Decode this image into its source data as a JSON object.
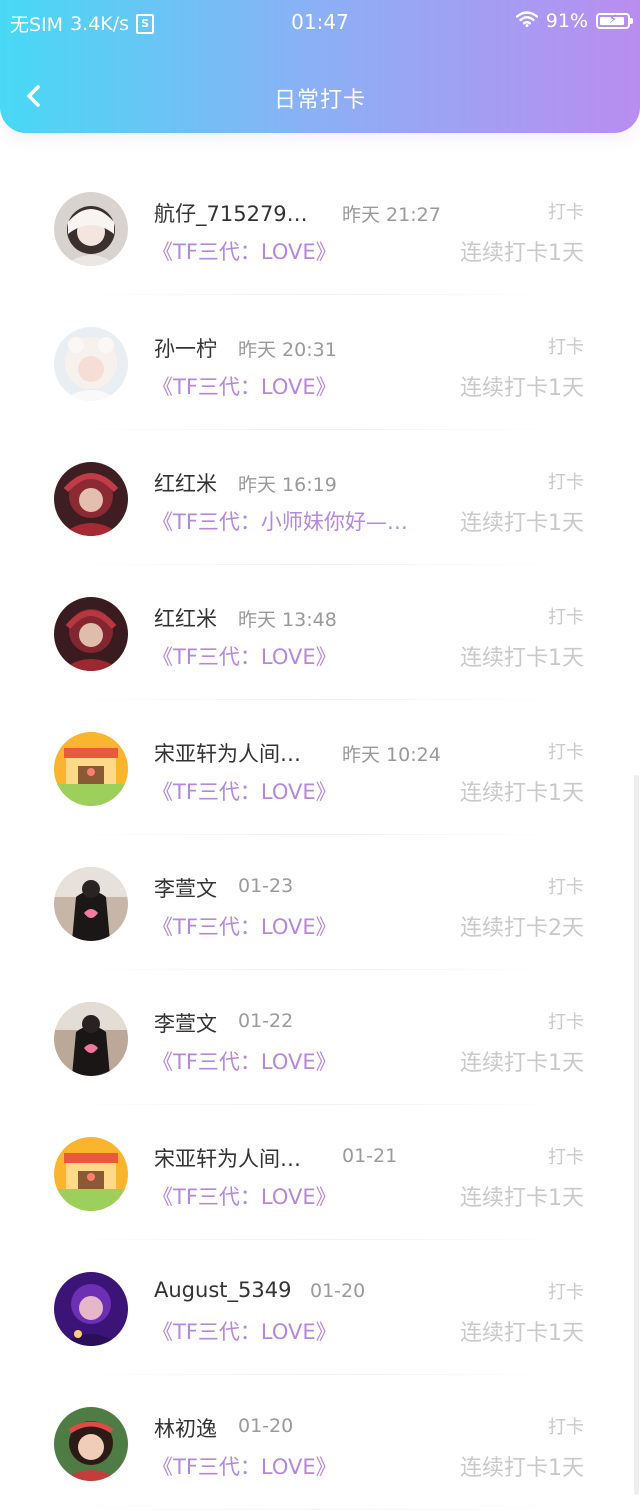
{
  "status_bar": {
    "carrier": "无SIM",
    "speed": "3.4K/s",
    "sim_icon_text": "S",
    "time": "01:47",
    "battery_text": "91%",
    "battery_level": 0.91,
    "icons": [
      "sim-icon",
      "wifi-icon",
      "battery-icon"
    ]
  },
  "header": {
    "title": "日常打卡",
    "back_icon": "chevron-left-icon",
    "gradient_colors": [
      "#47d9f5",
      "#8ab1f5",
      "#b98df0"
    ]
  },
  "colors": {
    "book_title": "#b488dc",
    "name": "#333333",
    "muted": "#c9c9c9",
    "time": "#9a9a9a"
  },
  "checkins": [
    {
      "name": "航仔_715279…",
      "time": "昨天 21:27",
      "tag": "打卡",
      "book": "《TF三代：LOVE》",
      "streak": "连续打卡1天"
    },
    {
      "name": "孙一柠",
      "time": "昨天 20:31",
      "tag": "打卡",
      "book": "《TF三代：LOVE》",
      "streak": "连续打卡1天"
    },
    {
      "name": "红红米",
      "time": "昨天 16:19",
      "tag": "打卡",
      "book": "《TF三代：小师妹你好—…",
      "streak": "连续打卡1天"
    },
    {
      "name": "红红米",
      "time": "昨天 13:48",
      "tag": "打卡",
      "book": "《TF三代：LOVE》",
      "streak": "连续打卡1天"
    },
    {
      "name": "宋亚轩为人间…",
      "time": "昨天 10:24",
      "tag": "打卡",
      "book": "《TF三代：LOVE》",
      "streak": "连续打卡1天"
    },
    {
      "name": "李萱文",
      "time": "01-23",
      "tag": "打卡",
      "book": "《TF三代：LOVE》",
      "streak": "连续打卡2天"
    },
    {
      "name": "李萱文",
      "time": "01-22",
      "tag": "打卡",
      "book": "《TF三代：LOVE》",
      "streak": "连续打卡1天"
    },
    {
      "name": "宋亚轩为人间…",
      "time": "01-21",
      "tag": "打卡",
      "book": "《TF三代：LOVE》",
      "streak": "连续打卡1天"
    },
    {
      "name": "August_5349",
      "time": "01-20",
      "tag": "打卡",
      "book": "《TF三代：LOVE》",
      "streak": "连续打卡1天"
    },
    {
      "name": "林初逸",
      "time": "01-20",
      "tag": "打卡",
      "book": "《TF三代：LOVE》",
      "streak": "连续打卡1天"
    }
  ]
}
